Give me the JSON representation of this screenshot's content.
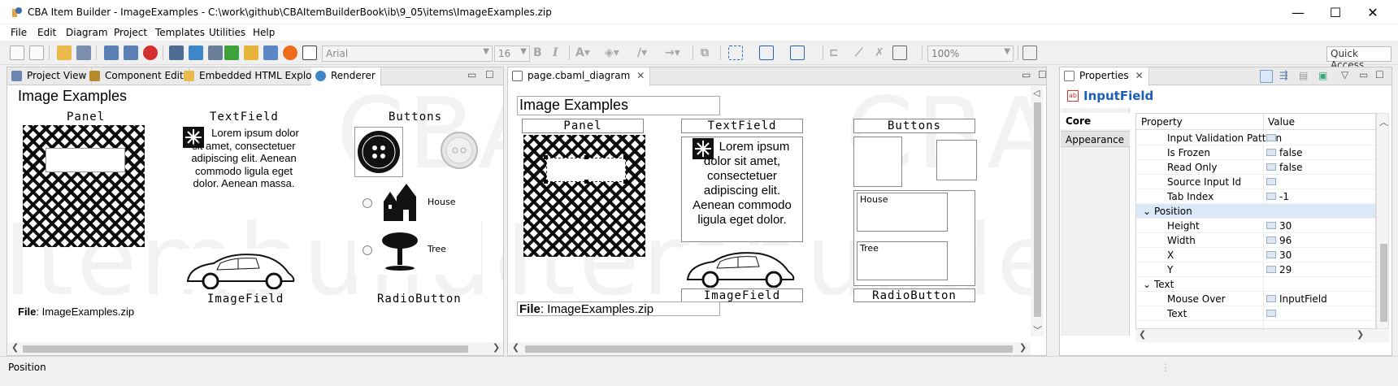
{
  "window": {
    "title": "CBA Item Builder - ImageExamples - C:\\work\\github\\CBAItemBuilderBook\\ib\\9_05\\items\\ImageExamples.zip",
    "minimize": "—",
    "maximize": "☐",
    "close": "✕"
  },
  "menu": [
    "File",
    "Edit",
    "Diagram",
    "Project",
    "Templates",
    "Utilities",
    "Help"
  ],
  "toolbar": {
    "font_name": "Arial",
    "font_size": "16",
    "bold": "B",
    "italic": "I",
    "zoom": "100%",
    "quick_access": "Quick Access"
  },
  "left_panel": {
    "tabs": [
      "Project View",
      "Component Edit",
      "Embedded HTML Explorer",
      "Renderer"
    ],
    "active_tab": "Renderer",
    "watermark_top": "CBA",
    "watermark_bottom": "Itembuilder",
    "title": "Image Examples",
    "labels": {
      "panel": "Panel",
      "textfield": "TextField",
      "buttons": "Buttons",
      "imagefield": "ImageField",
      "radiobutton": "RadioButton"
    },
    "lorem": "Lorem ipsum dolor sit amet, consectetuer adipiscing elit. Aenean commodo ligula eget dolor. Aenean massa.",
    "radio_house": "House",
    "radio_tree": "Tree",
    "file_label": "File",
    "file_value": ": ImageExamples.zip"
  },
  "center_panel": {
    "tab": "page.cbaml_diagram",
    "close_icon": "✕",
    "watermark_top": "CBA",
    "watermark_bottom": "Itembuilder",
    "title": "Image Examples",
    "labels": {
      "panel": "Panel",
      "textfield": "TextField",
      "buttons": "Buttons",
      "imagefield": "ImageField",
      "radiobutton": "RadioButton"
    },
    "lorem": "Lorem ipsum dolor sit amet, consectetuer adipiscing elit. Aenean commodo ligula eget dolor.",
    "radio_house": "House",
    "radio_tree": "Tree",
    "file_label": "File",
    "file_value": ": ImageExamples.zip"
  },
  "properties": {
    "tab": "Properties",
    "close_icon": "✕",
    "component": "InputField",
    "side_tabs": [
      "Core",
      "Appearance"
    ],
    "active_side_tab": "Core",
    "col_property": "Property",
    "col_value": "Value",
    "rows": [
      {
        "key": "Input Validation Pattern",
        "value": "",
        "type": "item"
      },
      {
        "key": "Is Frozen",
        "value": "false",
        "type": "item"
      },
      {
        "key": "Read Only",
        "value": "false",
        "type": "item"
      },
      {
        "key": "Source Input Id",
        "value": "",
        "type": "item"
      },
      {
        "key": "Tab Index",
        "value": "-1",
        "type": "item"
      },
      {
        "key": "Position",
        "value": "",
        "type": "group",
        "expanded": true,
        "selected": true
      },
      {
        "key": "Height",
        "value": "30",
        "type": "item"
      },
      {
        "key": "Width",
        "value": "96",
        "type": "item"
      },
      {
        "key": "X",
        "value": "30",
        "type": "item"
      },
      {
        "key": "Y",
        "value": "29",
        "type": "item"
      },
      {
        "key": "Text",
        "value": "",
        "type": "group",
        "expanded": true
      },
      {
        "key": "Mouse Over",
        "value": "InputField",
        "type": "item"
      },
      {
        "key": "Text",
        "value": "",
        "type": "item"
      }
    ]
  },
  "status": {
    "text": "Position"
  },
  "colors": {
    "accent": "#1a5fb4",
    "selection": "#dbe8f8",
    "folder": "#e9b949"
  }
}
